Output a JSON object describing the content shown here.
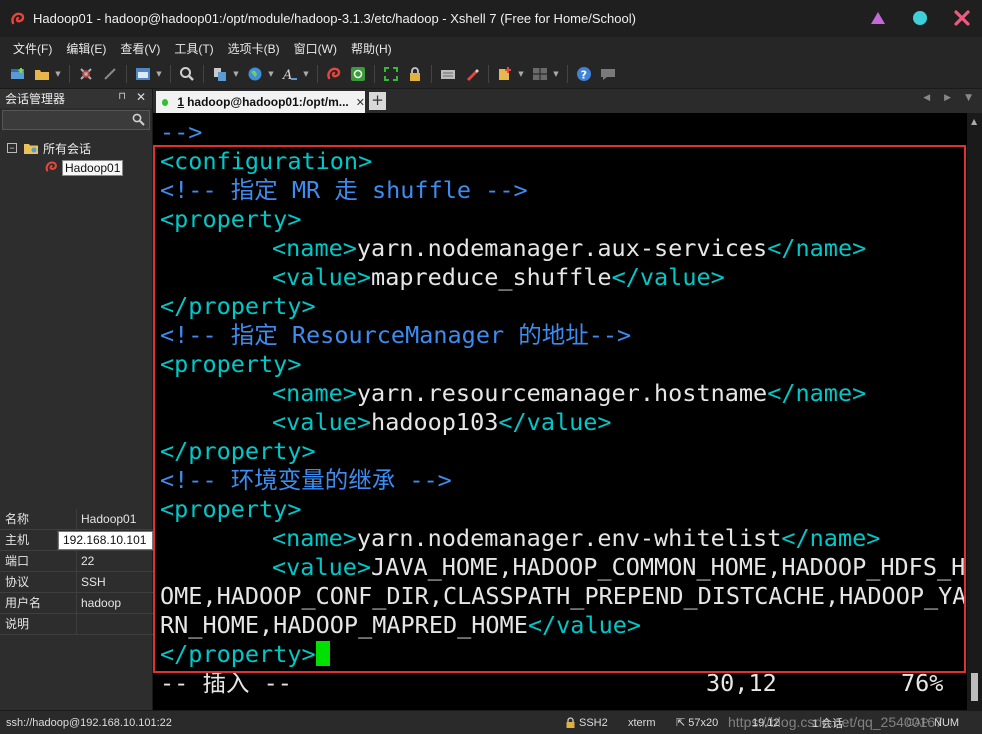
{
  "window": {
    "title": "Hadoop01 - hadoop@hadoop01:/opt/module/hadoop-3.1.3/etc/hadoop - Xshell 7 (Free for Home/School)"
  },
  "colors": {
    "accent": "#e03030",
    "tag": "#00c8c8",
    "comment": "#3d8cf0",
    "cursor": "#00e000",
    "tab_dot": "#2ec32e"
  },
  "menu": [
    "文件(F)",
    "编辑(E)",
    "查看(V)",
    "工具(T)",
    "选项卡(B)",
    "窗口(W)",
    "帮助(H)"
  ],
  "toolbar_icons": [
    "new-session-icon",
    "open-folder-icon",
    "disconnect-icon",
    "reconnect-icon",
    "new-window-icon",
    "find-icon",
    "transfer-icon",
    "globe-icon",
    "font-icon",
    "xshell-icon",
    "xftp-icon",
    "fullscreen-icon",
    "lock-icon",
    "keyboard-icon",
    "highlight-icon",
    "compose-icon",
    "tile-icon",
    "help-icon",
    "chat-icon"
  ],
  "session_manager": {
    "title": "会话管理器",
    "root_label": "所有会话",
    "session_label": "Hadoop01",
    "properties": [
      {
        "key": "名称",
        "value": "Hadoop01"
      },
      {
        "key": "主机",
        "value": "192.168.10.101"
      },
      {
        "key": "端口",
        "value": "22"
      },
      {
        "key": "协议",
        "value": "SSH"
      },
      {
        "key": "用户名",
        "value": "hadoop"
      },
      {
        "key": "说明",
        "value": ""
      }
    ]
  },
  "tab": {
    "number": "1",
    "label": "hadoop@hadoop01:/opt/m..."
  },
  "terminal": {
    "line0": "-->",
    "config_open": "<configuration>",
    "comment1": "<!-- 指定 MR 走 shuffle -->",
    "prop_open": "<property>",
    "prop_close": "</property>",
    "name_open": "<name>",
    "name_close": "</name>",
    "value_open": "<value>",
    "value_close": "</value>",
    "p1_name": "yarn.nodemanager.aux-services",
    "p1_value": "mapreduce_shuffle",
    "comment2": "<!-- 指定 ResourceManager 的地址-->",
    "p2_name": "yarn.resourcemanager.hostname",
    "p2_value": "hadoop103",
    "comment3": "<!-- 环境变量的继承 -->",
    "p3_name": "yarn.nodemanager.env-whitelist",
    "p3_value_l1": "JAVA_HOME,HADOOP_COMMON_HOME,HADOOP_HDFS_H",
    "p3_value_l2": "OME,HADOOP_CONF_DIR,CLASSPATH_PREPEND_DISTCACHE,HADOOP_YA",
    "p3_value_l3": "RN_HOME,HADOOP_MAPRED_HOME",
    "mode": "-- 插入 --",
    "position": "30,12",
    "percent": "76%"
  },
  "status": {
    "connection": "ssh://hadoop@192.168.10.101:22",
    "protocol": "SSH2",
    "term": "xterm",
    "size": "57x20",
    "cursor": "19,12",
    "sessions": "1 会话",
    "cap": "CAP",
    "num": "NUM",
    "watermark": "https://blog.csdn.net/qq_25400167"
  }
}
